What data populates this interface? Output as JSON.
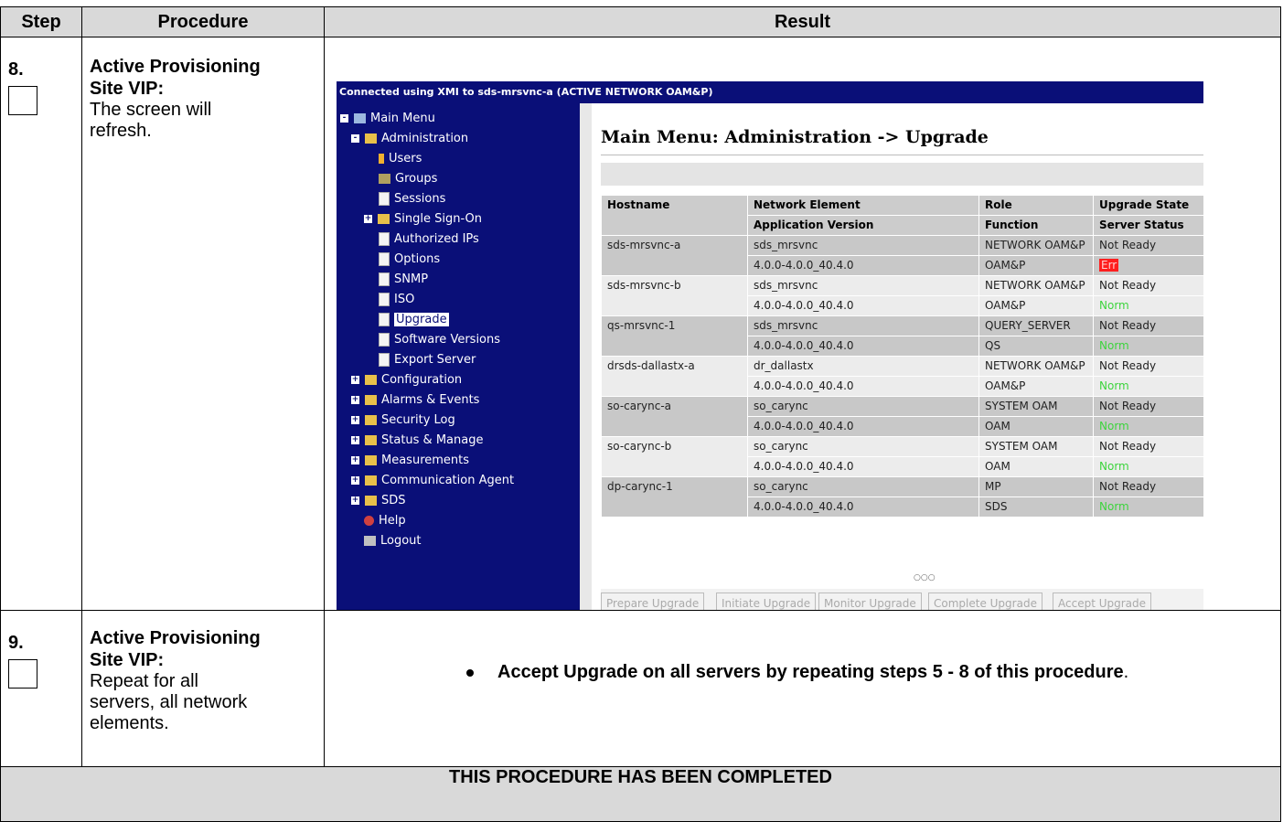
{
  "table": {
    "headers": {
      "step": "Step",
      "procedure": "Procedure",
      "result": "Result"
    },
    "rows": [
      {
        "step": "8.",
        "proc_title_1": "Active Provisioning",
        "proc_title_2": "Site VIP:",
        "proc_text": [
          "The screen will",
          "refresh."
        ]
      },
      {
        "step": "9.",
        "proc_title_1": "Active Provisioning",
        "proc_title_2": "Site VIP:",
        "proc_text": [
          "Repeat for all",
          "servers, all network",
          "elements."
        ],
        "result_bullet_bold": "Accept Upgrade on all servers by repeating steps 5 - 8 of this procedure",
        "result_bullet_tail": "."
      }
    ],
    "footer": "THIS PROCEDURE HAS BEEN COMPLETED"
  },
  "screenshot": {
    "banner": "Connected using XMI to sds-mrsvnc-a (ACTIVE NETWORK OAM&P)",
    "nav": {
      "main_menu": "Main Menu",
      "administration": "Administration",
      "users": "Users",
      "groups": "Groups",
      "sessions": "Sessions",
      "single_sign_on": "Single Sign-On",
      "authorized_ips": "Authorized IPs",
      "options": "Options",
      "snmp": "SNMP",
      "iso": "ISO",
      "upgrade": "Upgrade",
      "software_versions": "Software Versions",
      "export_server": "Export Server",
      "configuration": "Configuration",
      "alarms_events": "Alarms & Events",
      "security_log": "Security Log",
      "status_manage": "Status & Manage",
      "measurements": "Measurements",
      "communication_agent": "Communication Agent",
      "sds": "SDS",
      "help": "Help",
      "logout": "Logout"
    },
    "title": "Main Menu: Administration -> Upgrade",
    "grid": {
      "head1": [
        "Hostname",
        "Network Element",
        "Role",
        "Upgrade State"
      ],
      "head2": [
        "Application Version",
        "Function",
        "Server Status"
      ],
      "rows": [
        {
          "host": "sds-mrsvnc-a",
          "ne": "sds_mrsvnc",
          "ver": "4.0.0-4.0.0_40.4.0",
          "role": "NETWORK OAM&P",
          "func": "OAM&P",
          "state": "Not Ready",
          "status": "Err"
        },
        {
          "host": "sds-mrsvnc-b",
          "ne": "sds_mrsvnc",
          "ver": "4.0.0-4.0.0_40.4.0",
          "role": "NETWORK OAM&P",
          "func": "OAM&P",
          "state": "Not Ready",
          "status": "Norm"
        },
        {
          "host": "qs-mrsvnc-1",
          "ne": "sds_mrsvnc",
          "ver": "4.0.0-4.0.0_40.4.0",
          "role": "QUERY_SERVER",
          "func": "QS",
          "state": "Not Ready",
          "status": "Norm"
        },
        {
          "host": "drsds-dallastx-a",
          "ne": "dr_dallastx",
          "ver": "4.0.0-4.0.0_40.4.0",
          "role": "NETWORK OAM&P",
          "func": "OAM&P",
          "state": "Not Ready",
          "status": "Norm"
        },
        {
          "host": "so-carync-a",
          "ne": "so_carync",
          "ver": "4.0.0-4.0.0_40.4.0",
          "role": "SYSTEM OAM",
          "func": "OAM",
          "state": "Not Ready",
          "status": "Norm"
        },
        {
          "host": "so-carync-b",
          "ne": "so_carync",
          "ver": "4.0.0-4.0.0_40.4.0",
          "role": "SYSTEM OAM",
          "func": "OAM",
          "state": "Not Ready",
          "status": "Norm"
        },
        {
          "host": "dp-carync-1",
          "ne": "so_carync",
          "ver": "4.0.0-4.0.0_40.4.0",
          "role": "MP",
          "func": "SDS",
          "state": "Not Ready",
          "status": "Norm"
        }
      ]
    },
    "buttons": {
      "prepare": "Prepare Upgrade",
      "initiate": "Initiate Upgrade",
      "monitor": "Monitor Upgrade",
      "complete": "Complete Upgrade",
      "accept": "Accept Upgrade"
    },
    "colors": {
      "nav_bg": "#0a0f78",
      "status_ok": "#3cd43c",
      "status_err": "#ff1e1e"
    }
  }
}
